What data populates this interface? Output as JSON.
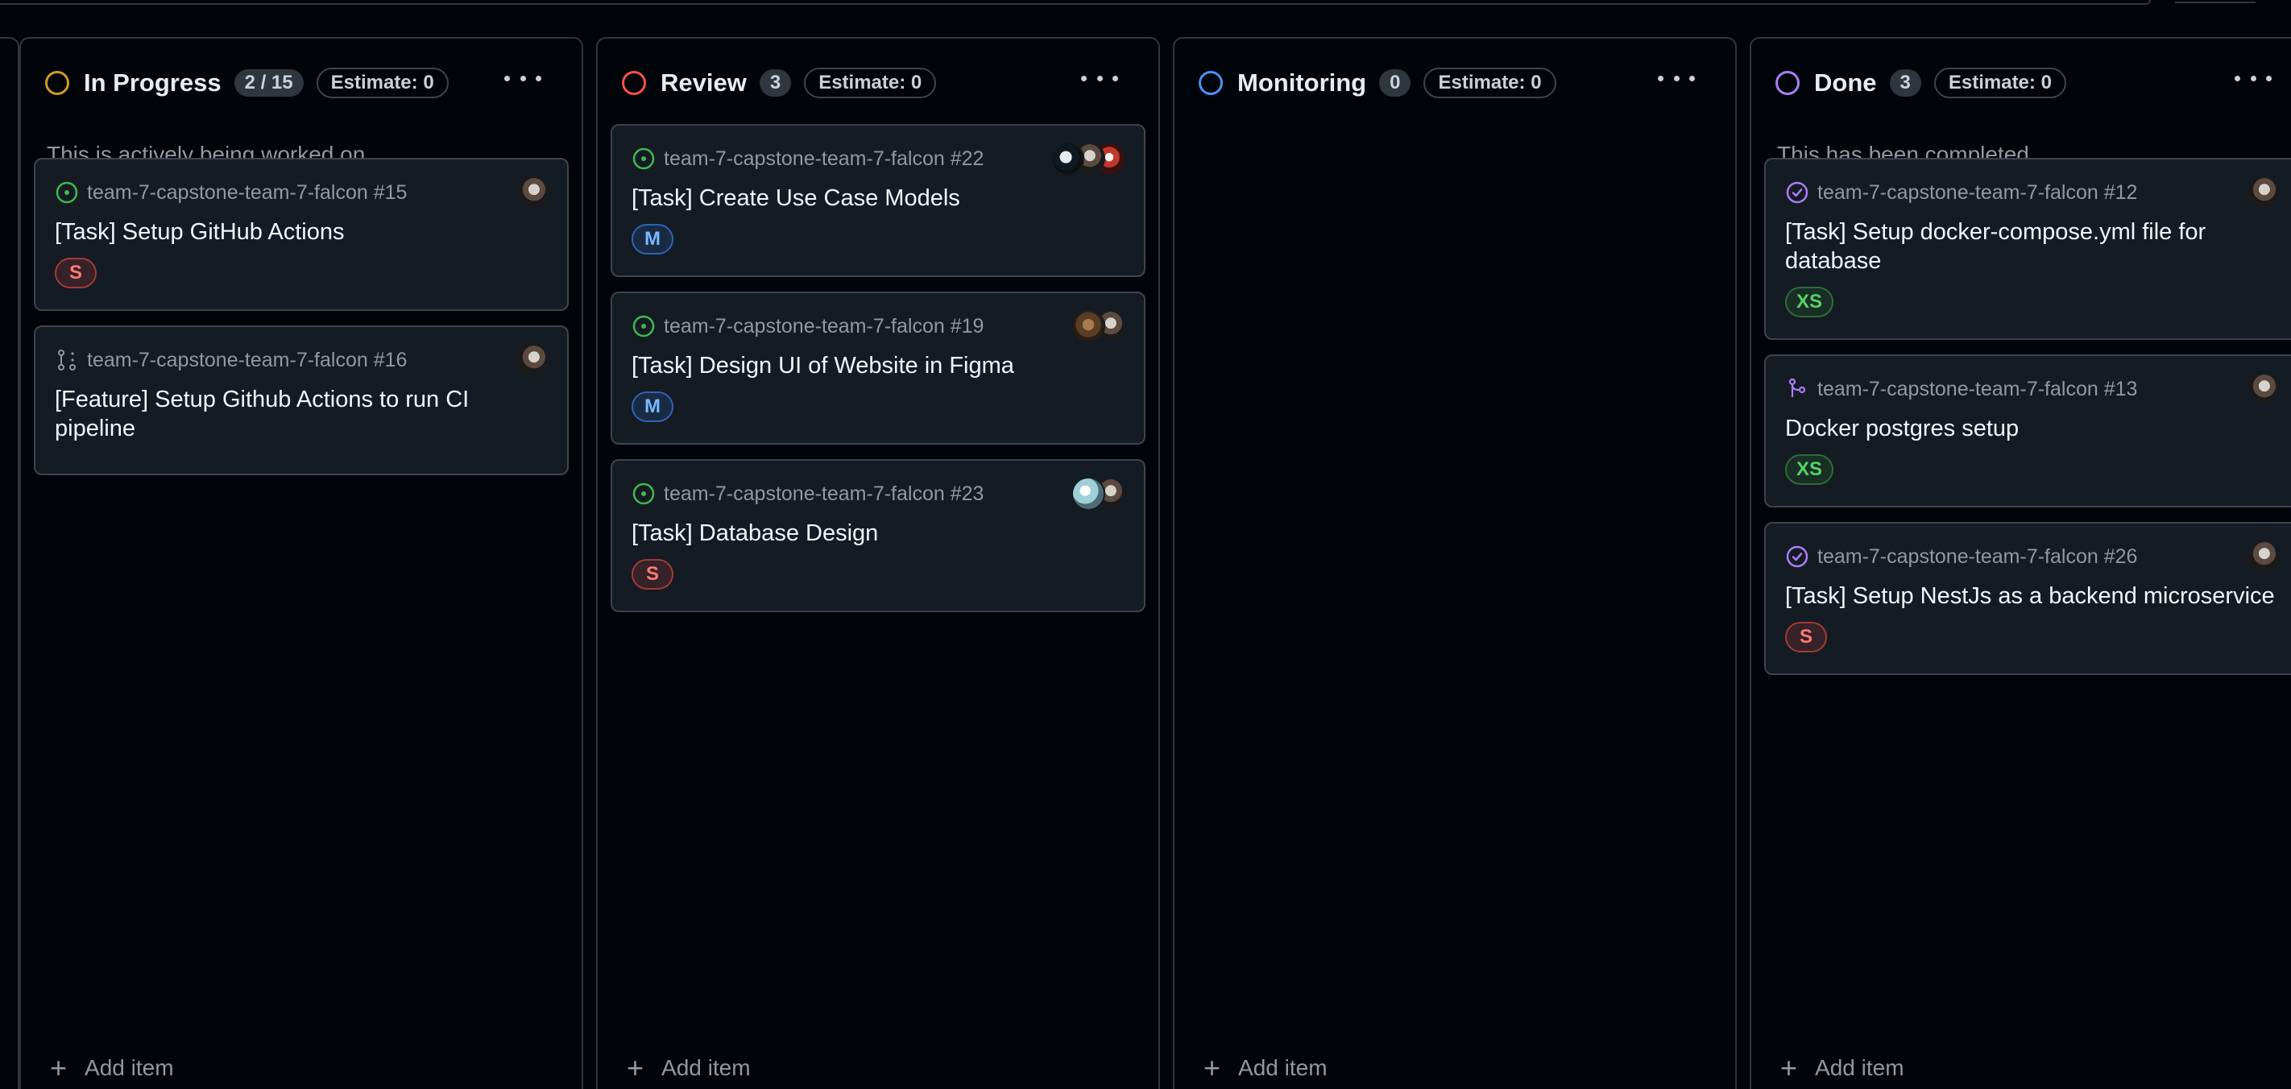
{
  "colors": {
    "background": "#010409",
    "card": "#151b23",
    "border": "#30363d",
    "in_progress": "#d29922",
    "review": "#f85149",
    "monitoring": "#4493f8",
    "done": "#ab7df8",
    "open_issue": "#3fb950",
    "closed_issue": "#ab7df8"
  },
  "board": {
    "add_item_label": "Add item",
    "columns": [
      {
        "title": "In Progress",
        "count": "2 / 15",
        "estimate": "Estimate: 0",
        "description": "This is actively being worked on",
        "status_color": "#d29922",
        "cards": [
          {
            "repo_ref": "team-7-capstone-team-7-falcon #15",
            "title": "[Task] Setup GitHub Actions",
            "size": "S",
            "icon": "issue-open-icon"
          },
          {
            "repo_ref": "team-7-capstone-team-7-falcon #16",
            "title": "[Feature] Setup Github Actions to run CI pipeline",
            "size": "",
            "icon": "pull-request-draft-icon"
          }
        ]
      },
      {
        "title": "Review",
        "count": "3",
        "estimate": "Estimate: 0",
        "description": "",
        "status_color": "#f85149",
        "cards": [
          {
            "repo_ref": "team-7-capstone-team-7-falcon #22",
            "title": "[Task] Create Use Case Models",
            "size": "M",
            "icon": "issue-open-icon"
          },
          {
            "repo_ref": "team-7-capstone-team-7-falcon #19",
            "title": "[Task] Design UI of Website in Figma",
            "size": "M",
            "icon": "issue-open-icon"
          },
          {
            "repo_ref": "team-7-capstone-team-7-falcon #23",
            "title": "[Task] Database Design",
            "size": "S",
            "icon": "issue-open-icon"
          }
        ]
      },
      {
        "title": "Monitoring",
        "count": "0",
        "estimate": "Estimate: 0",
        "description": "",
        "status_color": "#4493f8",
        "cards": []
      },
      {
        "title": "Done",
        "count": "3",
        "estimate": "Estimate: 0",
        "description": "This has been completed",
        "status_color": "#ab7df8",
        "cards": [
          {
            "repo_ref": "team-7-capstone-team-7-falcon #12",
            "title": "[Task] Setup docker-compose.yml file for database",
            "size": "XS",
            "icon": "issue-closed-icon"
          },
          {
            "repo_ref": "team-7-capstone-team-7-falcon #13",
            "title": "Docker postgres setup",
            "size": "XS",
            "icon": "pull-request-merged-icon"
          },
          {
            "repo_ref": "team-7-capstone-team-7-falcon #26",
            "title": "[Task] Setup NestJs as a backend microservice",
            "size": "S",
            "icon": "issue-closed-icon"
          }
        ]
      }
    ]
  }
}
